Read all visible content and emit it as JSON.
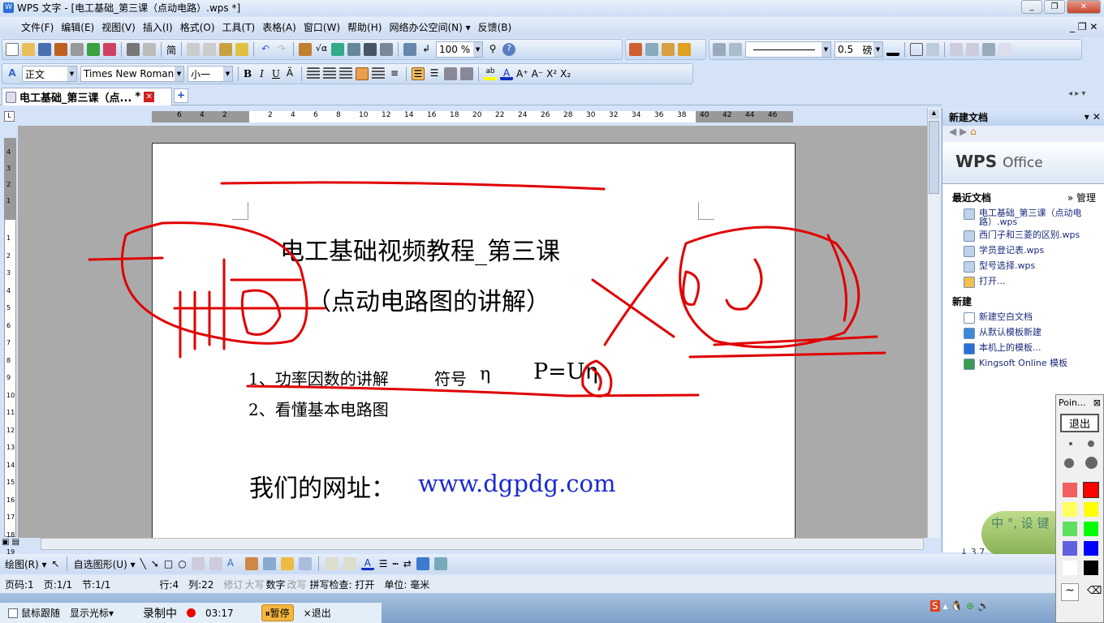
{
  "window": {
    "title": "WPS 文字 - [电工基础_第三课（点动电路）.wps *]",
    "min": "_",
    "restore": "❐",
    "close": "✕"
  },
  "menu": [
    "文件(F)",
    "编辑(E)",
    "视图(V)",
    "插入(I)",
    "格式(O)",
    "工具(T)",
    "表格(A)",
    "窗口(W)",
    "帮助(H)",
    "网络办公空间(N) ▾",
    "反馈(B)"
  ],
  "toolbar": {
    "simplified": "简",
    "zoom": "100 %",
    "line_width": "0.5",
    "line_unit": "磅"
  },
  "format": {
    "style": "正文",
    "font": "Times New Roman",
    "size": "小一",
    "bold": "B",
    "italic": "I",
    "underline": "U",
    "grow": "A⁺",
    "shrink": "A⁻",
    "sup": "X²",
    "sub": "X₂"
  },
  "tab": {
    "label": "电工基础_第三课（点...",
    "modified": "*",
    "close": "✕",
    "new": "+"
  },
  "ruler": {
    "h_ticks": [
      "6",
      "4",
      "2",
      "2",
      "4",
      "6",
      "8",
      "10",
      "12",
      "14",
      "16",
      "18",
      "20",
      "22",
      "24",
      "26",
      "28",
      "30",
      "32",
      "34",
      "36",
      "38",
      "40",
      "42",
      "44",
      "46"
    ],
    "v_ticks": [
      "4",
      "3",
      "2",
      "1",
      "1",
      "2",
      "3",
      "4",
      "5",
      "6",
      "7",
      "8",
      "9",
      "10",
      "11",
      "12",
      "13",
      "14",
      "15",
      "16",
      "17",
      "18",
      "19"
    ]
  },
  "document": {
    "title": "电工基础视频教程_第三课",
    "subtitle": "（点动电路图的讲解）",
    "item1": "1、功率因数的讲解",
    "symbol_label": "符号",
    "symbol": "η",
    "formula": "P=Uη",
    "item2": "2、看懂基本电路图",
    "site_label": "我们的网址：",
    "site_url": "www.dgpdg.com"
  },
  "annotation_color": "#e00000",
  "taskpane": {
    "title": "新建文档",
    "logo": "WPS",
    "logo_sub": "Office",
    "recent_heading": "最近文档",
    "manage": "» 管理",
    "recent": [
      "电工基础_第三课（点动电路）.wps",
      "西门子和三菱的区别.wps",
      "学员登记表.wps",
      "型号选择.wps"
    ],
    "open": "打开...",
    "new_heading": "新建",
    "new_items": [
      "新建空白文档",
      "从默认模板新建",
      "本机上的模板...",
      "Kingsoft Online 模板"
    ]
  },
  "drawbar": {
    "draw": "绘图(R) ▾",
    "autoshape": "自选图形(U) ▾"
  },
  "status": {
    "page": "页码:1",
    "pages": "页:1/1",
    "section": "节:1/1",
    "line": "行:4",
    "col": "列:22",
    "rev": "修订",
    "caps": "大写",
    "num": "数字",
    "ovr": "改写",
    "spell": "拼写检查: 打开",
    "unit": "单位: 毫米"
  },
  "recorder": {
    "follow": "鼠标跟随",
    "show_cursor": "显示光标▾",
    "recording": "录制中",
    "time": "03:17",
    "pause": "暂停",
    "exit": "×退出"
  },
  "pointer": {
    "title": "Poin...",
    "exit": "退出",
    "colors": [
      "#f06060",
      "#ff0000",
      "#ffff60",
      "#ffff00",
      "#60e060",
      "#00ff00",
      "#6060e0",
      "#0000ff",
      "#ffffff",
      "#000000"
    ]
  },
  "ime": {
    "chars": "中 °, 设 键"
  },
  "download": "↓ 3.7..."
}
